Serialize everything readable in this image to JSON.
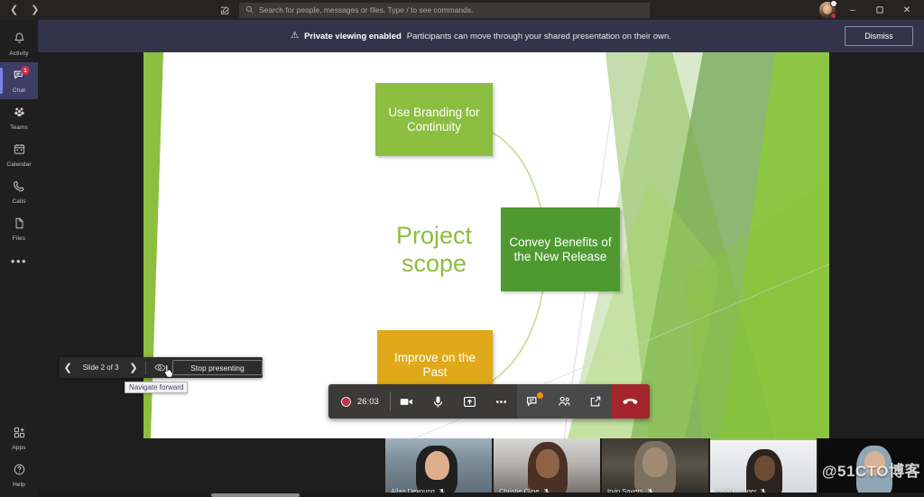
{
  "titlebar": {
    "back_icon": "chevron-left-icon",
    "forward_icon": "chevron-right-icon",
    "compose_icon": "compose-message-icon",
    "search_icon": "search-icon",
    "search_placeholder": "Search for people, messages or files. Type / to see commands.",
    "search_value": "",
    "minimize_label": "–",
    "maximize_label": "❑",
    "close_label": "✕"
  },
  "rail": {
    "items": [
      {
        "label": "Activity",
        "icon": "bell-icon",
        "badge": "",
        "active": false
      },
      {
        "label": "Chat",
        "icon": "chat-icon",
        "badge": "1",
        "active": true
      },
      {
        "label": "Teams",
        "icon": "teams-icon",
        "badge": "",
        "active": false
      },
      {
        "label": "Calendar",
        "icon": "calendar-icon",
        "badge": "",
        "active": false
      },
      {
        "label": "Calls",
        "icon": "phone-icon",
        "badge": "",
        "active": false
      },
      {
        "label": "Files",
        "icon": "files-icon",
        "badge": "",
        "active": false
      }
    ],
    "more_label": "•••",
    "bottom_items": [
      {
        "label": "Apps",
        "icon": "apps-icon"
      },
      {
        "label": "Help",
        "icon": "help-icon"
      }
    ]
  },
  "banner": {
    "warning_icon": "warning-triangle-icon",
    "title": "Private viewing enabled",
    "message": "Participants can move through your shared presentation on their own.",
    "dismiss_label": "Dismiss"
  },
  "slide": {
    "center_label": "Project scope",
    "page_number": "2",
    "nodes": [
      {
        "text": "Use Branding for Continuity",
        "color": "#8cbe3f"
      },
      {
        "text": "Convey Benefits of the New Release",
        "color": "#4e9a31"
      },
      {
        "text": "Improve on the Past",
        "color": "#dfa919"
      }
    ]
  },
  "slide_nav": {
    "prev_icon": "chevron-left-icon",
    "next_icon": "chevron-right-icon",
    "counter": "Slide 2 of 3",
    "eye_icon": "private-view-eye-icon",
    "stop_label": "Stop presenting",
    "tooltip": "Navigate forward",
    "cursor_icon": "hand-pointer-cursor"
  },
  "controls": {
    "record_icon": "recording-dot-icon",
    "timer": "26:03",
    "buttons": [
      {
        "name": "camera-button",
        "icon": "video-camera-icon",
        "badge": false
      },
      {
        "name": "microphone-button",
        "icon": "microphone-icon",
        "badge": false
      },
      {
        "name": "share-screen-button",
        "icon": "share-tray-icon",
        "badge": false
      },
      {
        "name": "more-actions-button",
        "icon": "ellipsis-icon",
        "badge": false
      },
      {
        "name": "chat-button",
        "icon": "conversation-icon",
        "badge": true
      },
      {
        "name": "participants-button",
        "icon": "people-icon",
        "badge": false
      },
      {
        "name": "popout-button",
        "icon": "pop-out-icon",
        "badge": false
      }
    ],
    "hangup_icon": "hangup-phone-icon"
  },
  "filmstrip": {
    "mute_icon": "mic-muted-icon",
    "participants": [
      {
        "name": "Allan Deyoung",
        "muted": true,
        "speaking": false
      },
      {
        "name": "Christie Cline",
        "muted": true,
        "speaking": false
      },
      {
        "name": "Irvin Sayers",
        "muted": true,
        "speaking": false
      },
      {
        "name": "Isaiah Langer",
        "muted": true,
        "speaking": true
      },
      {
        "name": "",
        "muted": false,
        "speaking": false
      }
    ]
  },
  "watermark": {
    "text": "@51CTO博客"
  }
}
